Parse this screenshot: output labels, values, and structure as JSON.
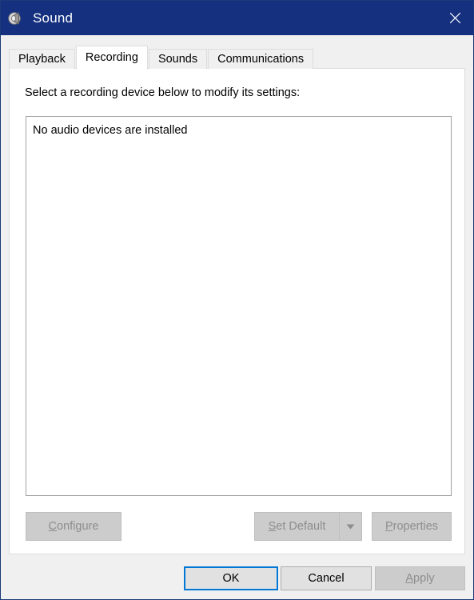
{
  "window": {
    "title": "Sound",
    "icon": "speaker-icon",
    "close_label": "✕",
    "accent_blue": "#14307f",
    "focus_blue": "#0078d7"
  },
  "tabs": [
    {
      "label": "Playback",
      "active": false
    },
    {
      "label": "Recording",
      "active": true
    },
    {
      "label": "Sounds",
      "active": false
    },
    {
      "label": "Communications",
      "active": false
    }
  ],
  "panel": {
    "instruction": "Select a recording device below to modify its settings:",
    "device_list": {
      "empty_message": "No audio devices are installed",
      "items": []
    },
    "actions": {
      "configure": {
        "label": "Configure",
        "accel": "C",
        "enabled": false
      },
      "set_default": {
        "label": "Set Default",
        "accel": "S",
        "enabled": false,
        "has_dropdown": true,
        "dropdown_icon": "chevron-down-icon"
      },
      "properties": {
        "label": "Properties",
        "accel": "P",
        "enabled": false
      }
    }
  },
  "footer": {
    "ok": {
      "label": "OK",
      "enabled": true,
      "is_default": true
    },
    "cancel": {
      "label": "Cancel",
      "enabled": true,
      "is_default": false
    },
    "apply": {
      "label": "Apply",
      "accel": "A",
      "enabled": false,
      "is_default": false
    }
  }
}
